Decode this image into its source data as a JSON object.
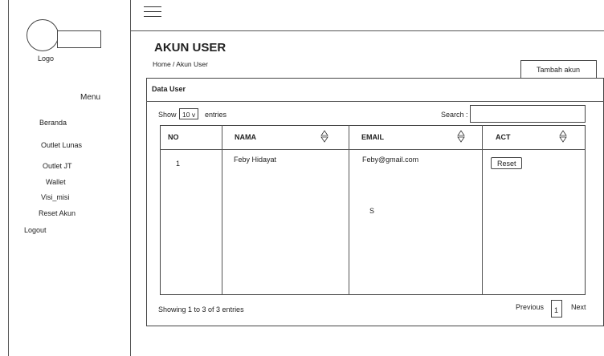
{
  "sidebar": {
    "logo_label": "Logo",
    "menu_heading": "Menu",
    "items": [
      {
        "label": "Beranda"
      },
      {
        "label": "Outlet Lunas"
      },
      {
        "label": "Outlet JT"
      },
      {
        "label": "Wallet"
      },
      {
        "label": "Visi_misi"
      },
      {
        "label": "Reset Akun"
      },
      {
        "label": "Logout"
      }
    ]
  },
  "header": {
    "menu_icon": "hamburger-icon",
    "page_title": "AKUN USER",
    "breadcrumb": "Home / Akun User",
    "add_button": "Tambah akun"
  },
  "panel": {
    "title": "Data User",
    "show_label": "Show",
    "entries_value": "10 v",
    "entries_label": "entries",
    "search_label": "Search :",
    "search_value": ""
  },
  "table": {
    "columns": [
      "NO",
      "NAMA",
      "EMAIL",
      "ACT"
    ],
    "sort_icon": "sort-updown-icon",
    "rows": [
      {
        "no": "1",
        "nama": "Feby Hidayat",
        "email": "Feby@gmail.com",
        "act": "Reset"
      }
    ],
    "stray_text": "S"
  },
  "footer": {
    "info": "Showing 1 to 3 of 3 entries",
    "previous": "Previous",
    "page": "1",
    "next": "Next"
  }
}
